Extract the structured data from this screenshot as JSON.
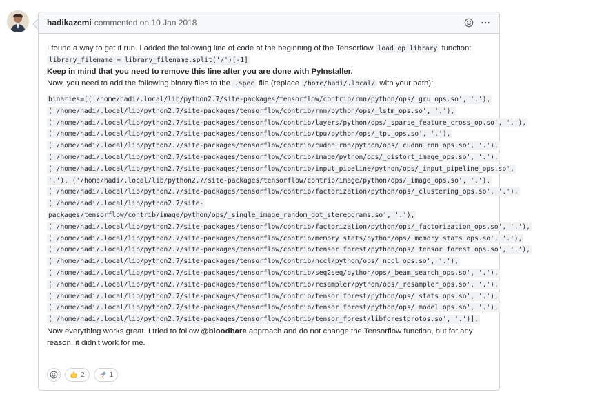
{
  "comment": {
    "author": "hadikazemi",
    "meta": "commented on 10 Jan 2018",
    "intro_text": "I found a way to get it run. I added the following line of code at the beginning of the Tensorflow",
    "intro_code": "load_op_library",
    "intro_suffix": "function:",
    "code_line": "library_filename = library_filename.split('/')[-1]",
    "warning": "Keep in mind that you need to remove this line after you are done with PyInstaller.",
    "add_prefix": "Now, you need to add the following binary files to the",
    "spec_code": ".spec",
    "add_middle": "file (replace",
    "path_code": "/home/hadi/.local/",
    "add_suffix": "with your path):",
    "binaries": [
      "binaries=[('/home/hadi/.local/lib/python2.7/site-packages/tensorflow/contrib/rnn/python/ops/_gru_ops.so', '.'),",
      "('/home/hadi/.local/lib/python2.7/site-packages/tensorflow/contrib/rnn/python/ops/_lstm_ops.so', '.'),",
      "('/home/hadi/.local/lib/python2.7/site-packages/tensorflow/contrib/layers/python/ops/_sparse_feature_cross_op.so', '.'),",
      "('/home/hadi/.local/lib/python2.7/site-packages/tensorflow/contrib/tpu/python/ops/_tpu_ops.so', '.'),",
      "('/home/hadi/.local/lib/python2.7/site-packages/tensorflow/contrib/cudnn_rnn/python/ops/_cudnn_rnn_ops.so', '.'),",
      "('/home/hadi/.local/lib/python2.7/site-packages/tensorflow/contrib/image/python/ops/_distort_image_ops.so', '.'),",
      "('/home/hadi/.local/lib/python2.7/site-packages/tensorflow/contrib/input_pipeline/python/ops/_input_pipeline_ops.so',",
      "'.'), ('/home/hadi/.local/lib/python2.7/site-packages/tensorflow/contrib/image/python/ops/_image_ops.so', '.'),",
      "('/home/hadi/.local/lib/python2.7/site-packages/tensorflow/contrib/factorization/python/ops/_clustering_ops.so', '.'),",
      "('/home/hadi/.local/lib/python2.7/site-",
      "packages/tensorflow/contrib/image/python/ops/_single_image_random_dot_stereograms.so', '.'),",
      "('/home/hadi/.local/lib/python2.7/site-packages/tensorflow/contrib/factorization/python/ops/_factorization_ops.so', '.'),",
      "('/home/hadi/.local/lib/python2.7/site-packages/tensorflow/contrib/memory_stats/python/ops/_memory_stats_ops.so', '.'),",
      "('/home/hadi/.local/lib/python2.7/site-packages/tensorflow/contrib/tensor_forest/python/ops/_tensor_forest_ops.so', '.'),",
      "('/home/hadi/.local/lib/python2.7/site-packages/tensorflow/contrib/nccl/python/ops/_nccl_ops.so', '.'),",
      "('/home/hadi/.local/lib/python2.7/site-packages/tensorflow/contrib/seq2seq/python/ops/_beam_search_ops.so', '.'),",
      "('/home/hadi/.local/lib/python2.7/site-packages/tensorflow/contrib/resampler/python/ops/_resampler_ops.so', '.'),",
      "('/home/hadi/.local/lib/python2.7/site-packages/tensorflow/contrib/tensor_forest/python/ops/_stats_ops.so', '.'),",
      "('/home/hadi/.local/lib/python2.7/site-packages/tensorflow/contrib/tensor_forest/python/ops/_model_ops.so', '.'),",
      "('/home/hadi/.local/lib/python2.7/site-packages/tensorflow/contrib/tensor_forest/libforestprotos.so', '.')],"
    ],
    "outro_prefix": "Now everything works great. I tried to follow",
    "outro_mention": "@bloodbare",
    "outro_suffix": "approach and do not change the Tensorflow function, but for any reason, it didn't work for me."
  },
  "reactions": {
    "thumbs_up_count": "2",
    "rocket_count": "1"
  },
  "icons": {
    "header_smile": "smile-icon",
    "header_more": "kebab-icon"
  }
}
